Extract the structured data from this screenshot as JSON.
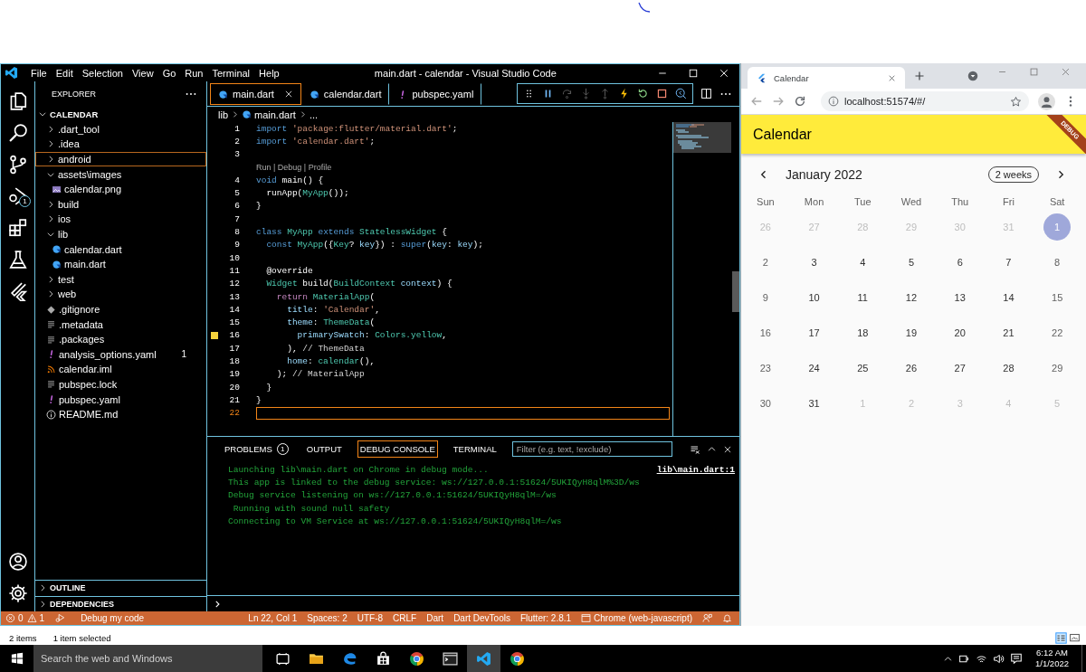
{
  "vscode": {
    "title": "main.dart - calendar - Visual Studio Code",
    "menu": [
      "File",
      "Edit",
      "Selection",
      "View",
      "Go",
      "Run",
      "Terminal",
      "Help"
    ],
    "activity_bar": {
      "debug_badge": "1"
    },
    "sidebar": {
      "title": "EXPLORER",
      "folder": {
        "label": "CALENDAR",
        "expanded": true
      },
      "tree": [
        {
          "label": ".dart_tool",
          "kind": "folder",
          "expanded": false,
          "selected": false
        },
        {
          "label": ".idea",
          "kind": "folder",
          "expanded": false,
          "selected": false
        },
        {
          "label": "android",
          "kind": "folder",
          "expanded": false,
          "selected": true
        },
        {
          "label": "assets\\images",
          "kind": "folder",
          "expanded": true,
          "selected": false,
          "children": [
            {
              "label": "calendar.png",
              "kind": "image",
              "selected": false
            }
          ]
        },
        {
          "label": "build",
          "kind": "folder",
          "expanded": false,
          "selected": false
        },
        {
          "label": "ios",
          "kind": "folder",
          "expanded": false,
          "selected": false
        },
        {
          "label": "lib",
          "kind": "folder",
          "expanded": true,
          "selected": false,
          "children": [
            {
              "label": "calendar.dart",
              "kind": "dart",
              "selected": false
            },
            {
              "label": "main.dart",
              "kind": "dart",
              "selected": false
            }
          ]
        },
        {
          "label": "test",
          "kind": "folder",
          "expanded": false,
          "selected": false
        },
        {
          "label": "web",
          "kind": "folder",
          "expanded": false,
          "selected": false
        },
        {
          "label": ".gitignore",
          "kind": "git",
          "selected": false
        },
        {
          "label": ".metadata",
          "kind": "text",
          "selected": false
        },
        {
          "label": ".packages",
          "kind": "text",
          "selected": false
        },
        {
          "label": "analysis_options.yaml",
          "kind": "yaml",
          "selected": false,
          "badge": "1"
        },
        {
          "label": "calendar.iml",
          "kind": "rss",
          "selected": false
        },
        {
          "label": "pubspec.lock",
          "kind": "text",
          "selected": false
        },
        {
          "label": "pubspec.yaml",
          "kind": "yaml",
          "selected": false
        },
        {
          "label": "README.md",
          "kind": "info",
          "selected": false
        }
      ],
      "sections": [
        {
          "label": "OUTLINE",
          "expanded": false
        },
        {
          "label": "DEPENDENCIES",
          "expanded": false
        }
      ]
    },
    "editor": {
      "tabs": [
        {
          "label": "main.dart",
          "kind": "dart",
          "selected": true
        },
        {
          "label": "calendar.dart",
          "kind": "dart",
          "selected": false
        },
        {
          "label": "pubspec.yaml",
          "kind": "yaml",
          "selected": false
        }
      ],
      "debug_toolbar": [
        {
          "disabled": false
        },
        {
          "disabled": false
        },
        {
          "disabled": true
        },
        {
          "disabled": true
        },
        {
          "disabled": true
        },
        {
          "disabled": false
        },
        {
          "disabled": false
        },
        {
          "disabled": false
        },
        {
          "disabled": false
        }
      ],
      "breadcrumb": [
        "lib",
        "main.dart",
        "..."
      ],
      "lines": [
        {
          "kind": "code",
          "number": "1",
          "marker": false,
          "current": false,
          "tokens": [
            {
              "kind": "kw",
              "text": "import "
            },
            {
              "kind": "str",
              "text": "'package:flutter/material.dart'"
            },
            {
              "kind": "plain",
              "text": ";"
            }
          ]
        },
        {
          "kind": "code",
          "number": "2",
          "marker": false,
          "current": false,
          "tokens": [
            {
              "kind": "kw",
              "text": "import "
            },
            {
              "kind": "str",
              "text": "'calendar.dart'"
            },
            {
              "kind": "plain",
              "text": ";"
            }
          ]
        },
        {
          "kind": "code",
          "number": "3",
          "marker": false,
          "current": false
        },
        {
          "kind": "codelens",
          "text": "Run | Debug | Profile"
        },
        {
          "kind": "code",
          "number": "4",
          "marker": false,
          "current": false,
          "tokens": [
            {
              "kind": "kw",
              "text": "void "
            },
            {
              "kind": "fn",
              "text": "main"
            },
            {
              "kind": "plain",
              "text": "() {"
            }
          ]
        },
        {
          "kind": "code",
          "number": "5",
          "marker": false,
          "current": false,
          "tokens": [
            {
              "kind": "fn",
              "text": "  runApp"
            },
            {
              "kind": "plain",
              "text": "("
            },
            {
              "kind": "type",
              "text": "MyApp"
            },
            {
              "kind": "plain",
              "text": "());"
            }
          ]
        },
        {
          "kind": "code",
          "number": "6",
          "marker": false,
          "current": false,
          "tokens": [
            {
              "kind": "plain",
              "text": "}"
            }
          ]
        },
        {
          "kind": "code",
          "number": "7",
          "marker": false,
          "current": false
        },
        {
          "kind": "code",
          "number": "8",
          "marker": false,
          "current": false,
          "tokens": [
            {
              "kind": "kw",
              "text": "class "
            },
            {
              "kind": "type",
              "text": "MyApp "
            },
            {
              "kind": "kw",
              "text": "extends "
            },
            {
              "kind": "type",
              "text": "StatelessWidget"
            },
            {
              "kind": "plain",
              "text": " {"
            }
          ]
        },
        {
          "kind": "code",
          "number": "9",
          "marker": false,
          "current": false,
          "tokens": [
            {
              "kind": "kw",
              "text": "  const "
            },
            {
              "kind": "type",
              "text": "MyApp"
            },
            {
              "kind": "plain",
              "text": "({"
            },
            {
              "kind": "type",
              "text": "Key"
            },
            {
              "kind": "plain",
              "text": "? "
            },
            {
              "kind": "var",
              "text": "key"
            },
            {
              "kind": "plain",
              "text": "}) : "
            },
            {
              "kind": "kw",
              "text": "super"
            },
            {
              "kind": "plain",
              "text": "("
            },
            {
              "kind": "var",
              "text": "key"
            },
            {
              "kind": "plain",
              "text": ": "
            },
            {
              "kind": "var",
              "text": "key"
            },
            {
              "kind": "plain",
              "text": ");"
            }
          ]
        },
        {
          "kind": "code",
          "number": "10",
          "marker": false,
          "current": false
        },
        {
          "kind": "code",
          "number": "11",
          "marker": false,
          "current": false,
          "tokens": [
            {
              "kind": "plain",
              "text": "  @override"
            }
          ]
        },
        {
          "kind": "code",
          "number": "12",
          "marker": false,
          "current": false,
          "tokens": [
            {
              "kind": "type",
              "text": "  Widget "
            },
            {
              "kind": "fn",
              "text": "build"
            },
            {
              "kind": "plain",
              "text": "("
            },
            {
              "kind": "type",
              "text": "BuildContext "
            },
            {
              "kind": "var",
              "text": "context"
            },
            {
              "kind": "plain",
              "text": ") {"
            }
          ]
        },
        {
          "kind": "code",
          "number": "13",
          "marker": false,
          "current": false,
          "tokens": [
            {
              "kind": "ctrl",
              "text": "    return "
            },
            {
              "kind": "type",
              "text": "MaterialApp"
            },
            {
              "kind": "plain",
              "text": "("
            }
          ]
        },
        {
          "kind": "code",
          "number": "14",
          "marker": false,
          "current": false,
          "tokens": [
            {
              "kind": "var",
              "text": "      title"
            },
            {
              "kind": "plain",
              "text": ": "
            },
            {
              "kind": "str",
              "text": "'Calendar'"
            },
            {
              "kind": "plain",
              "text": ","
            }
          ]
        },
        {
          "kind": "code",
          "number": "15",
          "marker": false,
          "current": false,
          "tokens": [
            {
              "kind": "var",
              "text": "      theme"
            },
            {
              "kind": "plain",
              "text": ": "
            },
            {
              "kind": "type",
              "text": "ThemeData"
            },
            {
              "kind": "plain",
              "text": "("
            }
          ]
        },
        {
          "kind": "code",
          "number": "16",
          "marker": true,
          "current": false,
          "tokens": [
            {
              "kind": "var",
              "text": "        primarySwatch"
            },
            {
              "kind": "plain",
              "text": ": "
            },
            {
              "kind": "type",
              "text": "Colors.yellow"
            },
            {
              "kind": "plain",
              "text": ","
            }
          ]
        },
        {
          "kind": "code",
          "number": "17",
          "marker": false,
          "current": false,
          "tokens": [
            {
              "kind": "plain",
              "text": "      ), "
            },
            {
              "kind": "comment",
              "text": "// ThemeData"
            }
          ]
        },
        {
          "kind": "code",
          "number": "18",
          "marker": false,
          "current": false,
          "tokens": [
            {
              "kind": "var",
              "text": "      home"
            },
            {
              "kind": "plain",
              "text": ": "
            },
            {
              "kind": "type",
              "text": "calendar"
            },
            {
              "kind": "plain",
              "text": "(),"
            }
          ]
        },
        {
          "kind": "code",
          "number": "19",
          "marker": false,
          "current": false,
          "tokens": [
            {
              "kind": "plain",
              "text": "    ); "
            },
            {
              "kind": "comment",
              "text": "// MaterialApp"
            }
          ]
        },
        {
          "kind": "code",
          "number": "20",
          "marker": false,
          "current": false,
          "tokens": [
            {
              "kind": "plain",
              "text": "  }"
            }
          ]
        },
        {
          "kind": "code",
          "number": "21",
          "marker": false,
          "current": false,
          "tokens": [
            {
              "kind": "plain",
              "text": "}"
            }
          ]
        },
        {
          "kind": "code",
          "number": "22",
          "marker": false,
          "current": true
        }
      ]
    },
    "panel": {
      "tabs": [
        {
          "label": "PROBLEMS",
          "badge": "1",
          "selected": false
        },
        {
          "label": "OUTPUT",
          "selected": false
        },
        {
          "label": "DEBUG CONSOLE",
          "selected": true
        },
        {
          "label": "TERMINAL",
          "selected": false
        }
      ],
      "filter": {
        "placeholder": "Filter (e.g. text, !exclude)"
      },
      "lines": [
        "Launching lib\\main.dart on Chrome in debug mode...",
        "This app is linked to the debug service: ws://127.0.0.1:51624/5UKIQyH8qlM%3D/ws",
        "Debug service listening on ws://127.0.0.1:51624/5UKIQyH8qlM=/ws",
        " Running with sound null safety",
        "Connecting to VM Service at ws://127.0.0.1:51624/5UKIQyH8qlM=/ws"
      ],
      "source_link": "lib\\main.dart:1"
    },
    "status_bar": {
      "left": [
        {
          "kind": "errors",
          "text": "0"
        },
        {
          "kind": "warnings",
          "text": "1"
        },
        {
          "kind": "launch",
          "text": "Debug my code"
        }
      ],
      "right": [
        {
          "kind": "text",
          "text": "Ln 22, Col 1"
        },
        {
          "kind": "text",
          "text": "Spaces: 2"
        },
        {
          "kind": "text",
          "text": "UTF-8"
        },
        {
          "kind": "text",
          "text": "CRLF"
        },
        {
          "kind": "text",
          "text": "Dart"
        },
        {
          "kind": "text",
          "text": "Dart DevTools"
        },
        {
          "kind": "text",
          "text": "Flutter: 2.8.1"
        },
        {
          "kind": "device",
          "text": "Chrome (web-javascript)"
        },
        {
          "kind": "feedback"
        },
        {
          "kind": "notifications"
        }
      ]
    }
  },
  "browser": {
    "tab": {
      "title": "Calendar"
    },
    "address": "localhost:51574/#/",
    "app": {
      "title": "Calendar",
      "debug_banner": "DEBUG",
      "month": "January 2022",
      "format_button": "2 weeks",
      "weekdays": [
        "Sun",
        "Mon",
        "Tue",
        "Wed",
        "Thu",
        "Fri",
        "Sat"
      ],
      "weeks": [
        [
          {
            "label": "26",
            "outside": true,
            "selected": false
          },
          {
            "label": "27",
            "outside": true,
            "selected": false
          },
          {
            "label": "28",
            "outside": true,
            "selected": false
          },
          {
            "label": "29",
            "outside": true,
            "selected": false
          },
          {
            "label": "30",
            "outside": true,
            "selected": false
          },
          {
            "label": "31",
            "outside": true,
            "selected": false
          },
          {
            "label": "1",
            "outside": false,
            "selected": true
          }
        ],
        [
          {
            "label": "2",
            "outside": false,
            "selected": false
          },
          {
            "label": "3",
            "outside": false,
            "selected": false
          },
          {
            "label": "4",
            "outside": false,
            "selected": false
          },
          {
            "label": "5",
            "outside": false,
            "selected": false
          },
          {
            "label": "6",
            "outside": false,
            "selected": false
          },
          {
            "label": "7",
            "outside": false,
            "selected": false
          },
          {
            "label": "8",
            "outside": false,
            "selected": false
          }
        ],
        [
          {
            "label": "9",
            "outside": false,
            "selected": false
          },
          {
            "label": "10",
            "outside": false,
            "selected": false
          },
          {
            "label": "11",
            "outside": false,
            "selected": false
          },
          {
            "label": "12",
            "outside": false,
            "selected": false
          },
          {
            "label": "13",
            "outside": false,
            "selected": false
          },
          {
            "label": "14",
            "outside": false,
            "selected": false
          },
          {
            "label": "15",
            "outside": false,
            "selected": false
          }
        ],
        [
          {
            "label": "16",
            "outside": false,
            "selected": false
          },
          {
            "label": "17",
            "outside": false,
            "selected": false
          },
          {
            "label": "18",
            "outside": false,
            "selected": false
          },
          {
            "label": "19",
            "outside": false,
            "selected": false
          },
          {
            "label": "20",
            "outside": false,
            "selected": false
          },
          {
            "label": "21",
            "outside": false,
            "selected": false
          },
          {
            "label": "22",
            "outside": false,
            "selected": false
          }
        ],
        [
          {
            "label": "23",
            "outside": false,
            "selected": false
          },
          {
            "label": "24",
            "outside": false,
            "selected": false
          },
          {
            "label": "25",
            "outside": false,
            "selected": false
          },
          {
            "label": "26",
            "outside": false,
            "selected": false
          },
          {
            "label": "27",
            "outside": false,
            "selected": false
          },
          {
            "label": "28",
            "outside": false,
            "selected": false
          },
          {
            "label": "29",
            "outside": false,
            "selected": false
          }
        ],
        [
          {
            "label": "30",
            "outside": false,
            "selected": false
          },
          {
            "label": "31",
            "outside": false,
            "selected": false
          },
          {
            "label": "1",
            "outside": true,
            "selected": false
          },
          {
            "label": "2",
            "outside": true,
            "selected": false
          },
          {
            "label": "3",
            "outside": true,
            "selected": false
          },
          {
            "label": "4",
            "outside": true,
            "selected": false
          },
          {
            "label": "5",
            "outside": true,
            "selected": false
          }
        ]
      ]
    }
  },
  "explorer_status": {
    "count": "2 items",
    "selection": "1 item selected"
  },
  "taskbar": {
    "search": {
      "placeholder": "Search the web and Windows"
    },
    "apps": [
      {
        "selected": false
      },
      {
        "selected": false
      },
      {
        "selected": false
      },
      {
        "selected": false
      },
      {
        "selected": false
      },
      {
        "selected": false
      },
      {
        "selected": true
      },
      {
        "selected": false
      }
    ],
    "clock": {
      "time": "6:12 AM",
      "date": "1/1/2022"
    }
  }
}
